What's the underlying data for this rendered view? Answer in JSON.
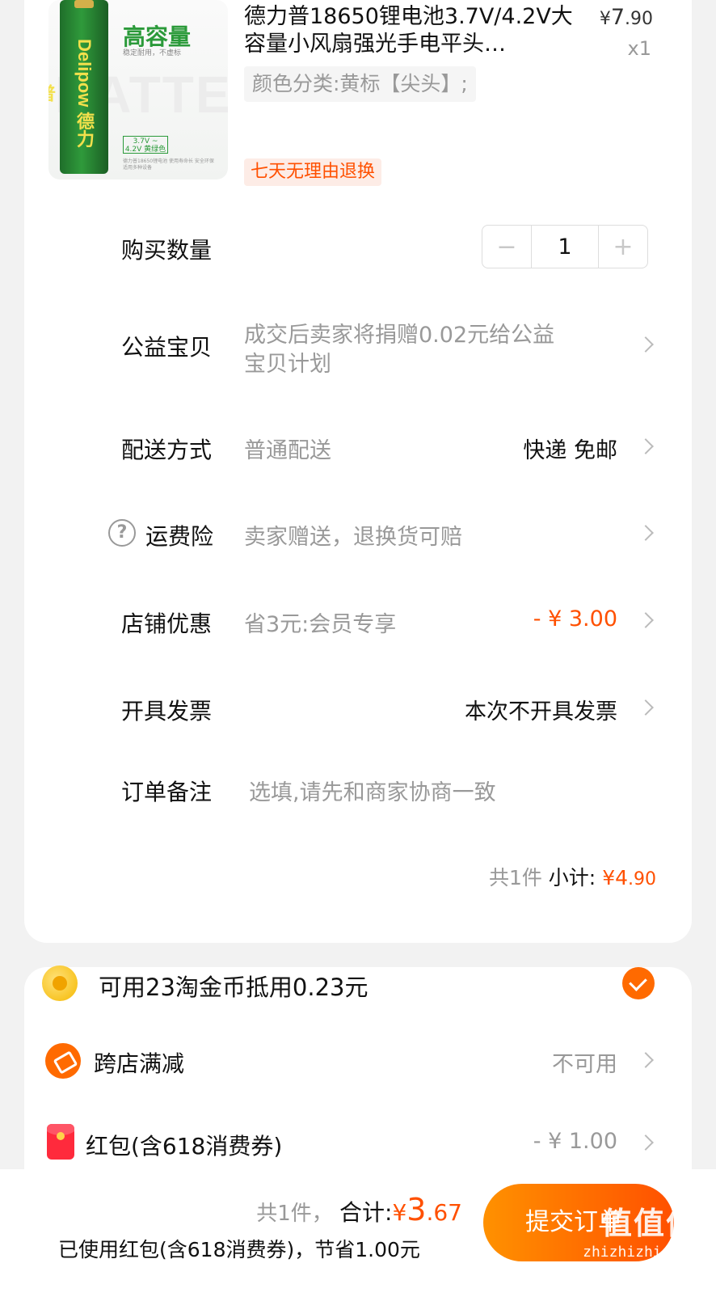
{
  "product": {
    "title": "德力普18650锂电池3.7V/4.2V大容量小风扇强光手电平头…",
    "price_yen": "¥",
    "price_int": "7",
    "price_dec": ".90",
    "quantity_text": "x1",
    "spec": "颜色分类:黄标【尖头】;",
    "return_tag": "七天无理由退换",
    "image": {
      "bg_word": "BATTERY",
      "brand": "Delipow 德力普",
      "headline": "高容量",
      "subline": "稳定耐用，不虚标",
      "voltage": "3.7V ~ 4.2V 黄绿色",
      "fine_print": "德力普18650锂电池 使用寿命长 安全环保 适用多种设备"
    }
  },
  "quantity": {
    "label": "购买数量",
    "minus": "−",
    "value": "1",
    "plus": "+"
  },
  "charity": {
    "label": "公益宝贝",
    "value_line1": "成交后卖家将捐赠0.02元给公益",
    "value_line2": "宝贝计划"
  },
  "delivery": {
    "label": "配送方式",
    "value": "普通配送",
    "right": "快递 免邮"
  },
  "shipping_insurance": {
    "help_icon": "?",
    "label": "运费险",
    "value": "卖家赠送，退换货可赔"
  },
  "shop_discount": {
    "label": "店铺优惠",
    "value": "省3元:会员专享",
    "amount": "- ¥ 3.00"
  },
  "invoice": {
    "label": "开具发票",
    "value": "本次不开具发票"
  },
  "note": {
    "label": "订单备注",
    "placeholder": "选填,请先和商家协商一致"
  },
  "subtotal": {
    "count": "共1件",
    "label": "小计:",
    "amount_int": "¥4",
    "amount_dec": ".90"
  },
  "coins": {
    "text": "可用23淘金币抵用0.23元"
  },
  "cross_shop": {
    "label": "跨店满减",
    "value": "不可用"
  },
  "red_packet": {
    "label": "红包(含618消费券)",
    "value": "- ¥ 1.00"
  },
  "footer": {
    "count": "共1件，",
    "total_label": "合计:",
    "total_yen": "¥",
    "total_int": "3",
    "total_dec": ".67",
    "used_text": "已使用红包(含618消费券)，节省1.00元",
    "submit": "提交订单",
    "watermark": "值值值",
    "watermark_url": "zhizhizhi.com"
  },
  "colors": {
    "accent": "#ff5000",
    "tag_bg": "#fdece6",
    "submit_start": "#ff9100",
    "submit_end": "#ff5000"
  }
}
